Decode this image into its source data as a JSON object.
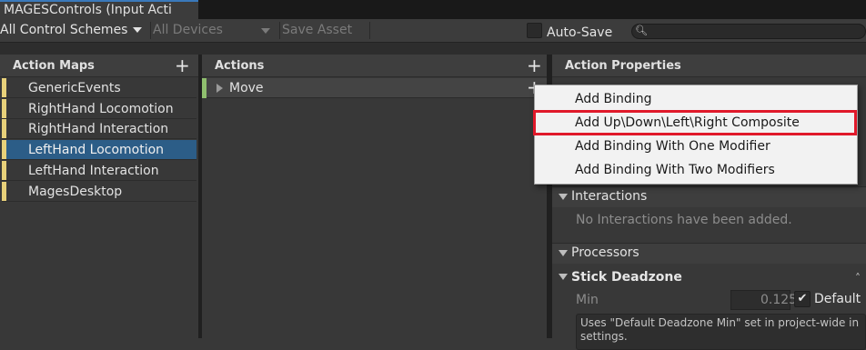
{
  "window": {
    "tab_title": "MAGESControls (Input Acti"
  },
  "toolbar": {
    "schemes_label": "All Control Schemes",
    "devices_label": "All Devices",
    "save_label": "Save Asset",
    "autosave_label": "Auto-Save",
    "autosave_checked": false,
    "search_value": ""
  },
  "panels": {
    "maps_title": "Action Maps",
    "actions_title": "Actions",
    "properties_title": "Action Properties"
  },
  "action_maps": [
    {
      "label": "GenericEvents",
      "selected": false
    },
    {
      "label": "RightHand Locomotion",
      "selected": false
    },
    {
      "label": "RightHand Interaction",
      "selected": false
    },
    {
      "label": "LeftHand Locomotion",
      "selected": true
    },
    {
      "label": "LeftHand Interaction",
      "selected": false
    },
    {
      "label": "MagesDesktop",
      "selected": false
    }
  ],
  "actions": [
    {
      "label": "Move"
    }
  ],
  "context_menu": {
    "items": [
      "Add Binding",
      "Add Up\\Down\\Left\\Right Composite",
      "Add Binding With One Modifier",
      "Add Binding With Two Modifiers"
    ],
    "highlighted_index": 1,
    "highlight_color": "#e0192a"
  },
  "properties": {
    "interactions_label": "Interactions",
    "no_interactions_text": "No Interactions have been added.",
    "processors_label": "Processors",
    "deadzone_label": "Stick Deadzone",
    "min_label": "Min",
    "min_value": "0.125",
    "default_label": "Default",
    "default_checked": true,
    "help_line1": "Uses \"Default Deadzone Min\" set in project-wide in",
    "help_line2": "settings."
  },
  "colors": {
    "map_bar": "#e8d17a",
    "action_bar": "#8fbf6e",
    "selection": "#2c5d87"
  },
  "icons": {
    "add": "plus-icon",
    "search": "search-icon",
    "dropdown": "chevron-down-icon",
    "expand": "triangle-right-icon",
    "foldout": "triangle-down-icon",
    "check": "checkmark-icon"
  }
}
